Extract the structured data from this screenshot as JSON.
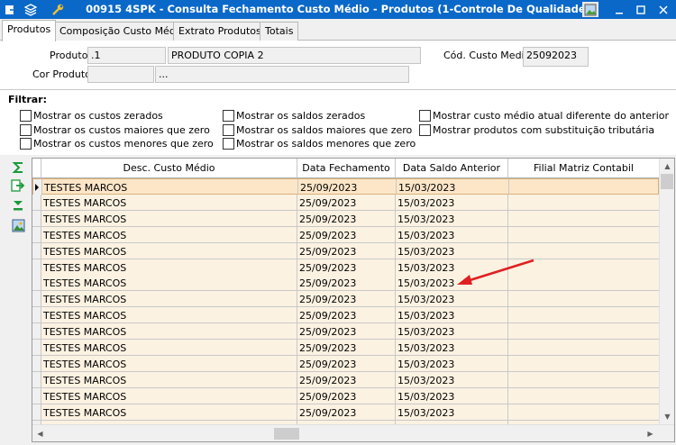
{
  "window": {
    "title": "00915 4SPK - Consulta Fechamento Custo Médio - Produtos (1-Controle De Qualidade)",
    "colors": {
      "titlebar": "#0a68c8",
      "row_bg": "#fcf2e2",
      "selected_row_bg": "#fde6c8",
      "arrow": "#e02020"
    }
  },
  "tabs": [
    {
      "label": "Produtos"
    },
    {
      "label": "Composição Custo Médio"
    },
    {
      "label": "Extrato Produtos"
    },
    {
      "label": "Totais"
    }
  ],
  "form": {
    "produto_label": "Produto",
    "produto_code": ".1",
    "produto_name": "PRODUTO COPIA 2",
    "cod_custo_label": "Cód. Custo Medio",
    "cod_custo_value": "25092023",
    "cor_label": "Cor Produto",
    "cor_code": "",
    "cor_name": "..."
  },
  "filter": {
    "title": "Filtrar:",
    "options": [
      "Mostrar os custos zerados",
      "Mostrar os custos maiores que zero",
      "Mostrar os custos menores que zero",
      "Mostrar os saldos zerados",
      "Mostrar os saldos maiores que zero",
      "Mostrar os saldos menores que zero",
      "Mostrar custo médio atual diferente do anterior",
      "Mostrar produtos com substituição tributária"
    ]
  },
  "toolbar_icons": [
    "sum-icon",
    "export-icon",
    "expand-down-icon",
    "image-icon"
  ],
  "grid": {
    "columns": [
      "Desc. Custo Médio",
      "Data Fechamento",
      "Data Saldo Anterior",
      "Filial Matriz Contabil"
    ],
    "rows": [
      [
        "TESTES MARCOS",
        "25/09/2023",
        "15/03/2023",
        ""
      ],
      [
        "TESTES MARCOS",
        "25/09/2023",
        "15/03/2023",
        ""
      ],
      [
        "TESTES MARCOS",
        "25/09/2023",
        "15/03/2023",
        ""
      ],
      [
        "TESTES MARCOS",
        "25/09/2023",
        "15/03/2023",
        ""
      ],
      [
        "TESTES MARCOS",
        "25/09/2023",
        "15/03/2023",
        ""
      ],
      [
        "TESTES MARCOS",
        "25/09/2023",
        "15/03/2023",
        ""
      ],
      [
        "TESTES MARCOS",
        "25/09/2023",
        "15/03/2023",
        ""
      ],
      [
        "TESTES MARCOS",
        "25/09/2023",
        "15/03/2023",
        ""
      ],
      [
        "TESTES MARCOS",
        "25/09/2023",
        "15/03/2023",
        ""
      ],
      [
        "TESTES MARCOS",
        "25/09/2023",
        "15/03/2023",
        ""
      ],
      [
        "TESTES MARCOS",
        "25/09/2023",
        "15/03/2023",
        ""
      ],
      [
        "TESTES MARCOS",
        "25/09/2023",
        "15/03/2023",
        ""
      ],
      [
        "TESTES MARCOS",
        "25/09/2023",
        "15/03/2023",
        ""
      ],
      [
        "TESTES MARCOS",
        "25/09/2023",
        "15/03/2023",
        ""
      ],
      [
        "TESTES MARCOS",
        "25/09/2023",
        "15/03/2023",
        ""
      ],
      [
        "TESTES MARCOS",
        "25/09/2023",
        "15/03/2023",
        ""
      ]
    ]
  }
}
